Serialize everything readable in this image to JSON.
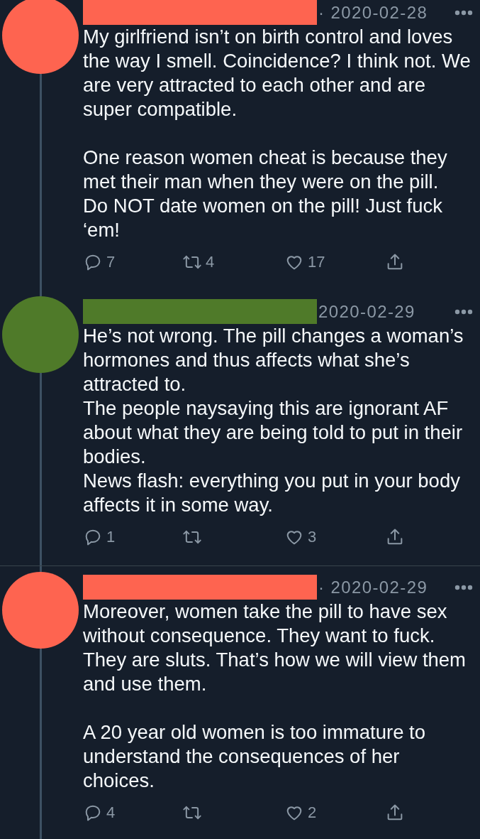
{
  "tweets": [
    {
      "color": "#fe6450",
      "divider_above": false,
      "date": "· 2020-02-28",
      "text": "My girlfriend isn’t on birth control and loves the way I smell. Coincidence? I think not. We are very attracted to each other and are super compatible.\n\nOne reason women cheat is because they met their man when they were on the pill.\nDo NOT date women on the pill! Just fuck ‘em!",
      "actions": [
        {
          "kind": "reply",
          "count": "7"
        },
        {
          "kind": "retweet",
          "count": "4"
        },
        {
          "kind": "like",
          "count": "17"
        },
        {
          "kind": "share"
        }
      ]
    },
    {
      "color": "#4f7a29",
      "divider_above": false,
      "date": "2020-02-29",
      "text": "He’s not wrong. The pill changes a woman’s hormones and thus affects what she’s attracted to.\nThe people naysaying this are ignorant AF about what they are being told to put in their bodies.\nNews flash: everything you put in your body affects it in some way.",
      "actions": [
        {
          "kind": "reply",
          "count": "1"
        },
        {
          "kind": "retweet"
        },
        {
          "kind": "like",
          "count": "3"
        },
        {
          "kind": "share"
        }
      ]
    },
    {
      "color": "#fe6450",
      "divider_above": true,
      "date": "· 2020-02-29",
      "text": "Moreover, women take the pill to have sex without consequence. They want to fuck. They are sluts. That’s how we will view them and use them.\n\nA 20 year old women is too immature to understand the consequences of her choices.",
      "actions": [
        {
          "kind": "reply",
          "count": "4"
        },
        {
          "kind": "retweet"
        },
        {
          "kind": "like",
          "count": "2"
        },
        {
          "kind": "share"
        }
      ]
    }
  ]
}
